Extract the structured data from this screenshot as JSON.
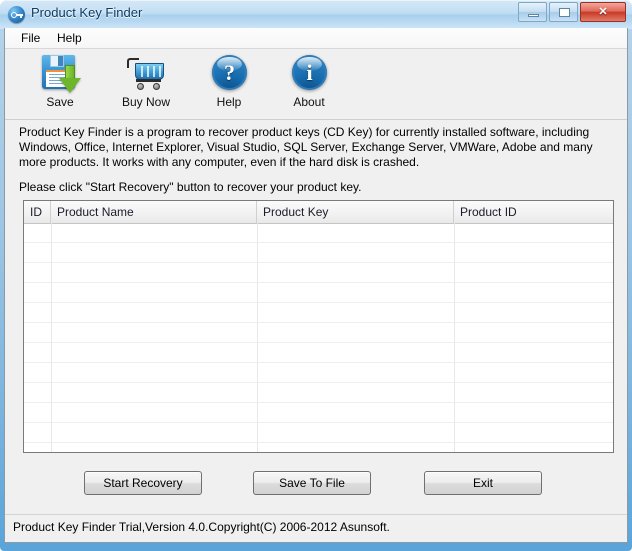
{
  "window": {
    "title": "Product Key Finder",
    "icon": "key-orb-icon",
    "controls": {
      "minimize": "Minimize",
      "maximize": "Maximize",
      "close": "✕"
    }
  },
  "menubar": {
    "items": [
      {
        "label": "File"
      },
      {
        "label": "Help"
      }
    ]
  },
  "toolbar": {
    "buttons": [
      {
        "label": "Save",
        "icon": "floppy-disk-save-icon"
      },
      {
        "label": "Buy Now",
        "icon": "shopping-cart-icon"
      },
      {
        "label": "Help",
        "icon": "question-mark-orb-icon",
        "symbol": "?"
      },
      {
        "label": "About",
        "icon": "info-orb-icon",
        "symbol": "i"
      }
    ]
  },
  "description": {
    "paragraph1": "Product Key Finder is a program to recover product keys (CD Key) for currently installed software, including Windows, Office, Internet Explorer, Visual Studio, SQL Server, Exchange Server, VMWare, Adobe and many more products. It works with any computer, even if the hard disk is crashed.",
    "paragraph2": "Please click \"Start Recovery\" button to recover your product key."
  },
  "table": {
    "columns": [
      {
        "label": "ID"
      },
      {
        "label": "Product Name"
      },
      {
        "label": "Product Key"
      },
      {
        "label": "Product ID"
      }
    ],
    "rows": [],
    "empty_row_count": 12
  },
  "actions": {
    "start_recovery": "Start Recovery",
    "save_to_file": "Save To File",
    "exit": "Exit"
  },
  "statusbar": {
    "text": "Product Key Finder Trial,Version 4.0.Copyright(C) 2006-2012 Asunsoft."
  },
  "colors": {
    "frame_blue": "#5aa4da",
    "client_bg": "#f0f0f0",
    "close_red": "#c63a27",
    "icon_blue": "#2f8fcf",
    "arrow_green": "#6db62b"
  }
}
